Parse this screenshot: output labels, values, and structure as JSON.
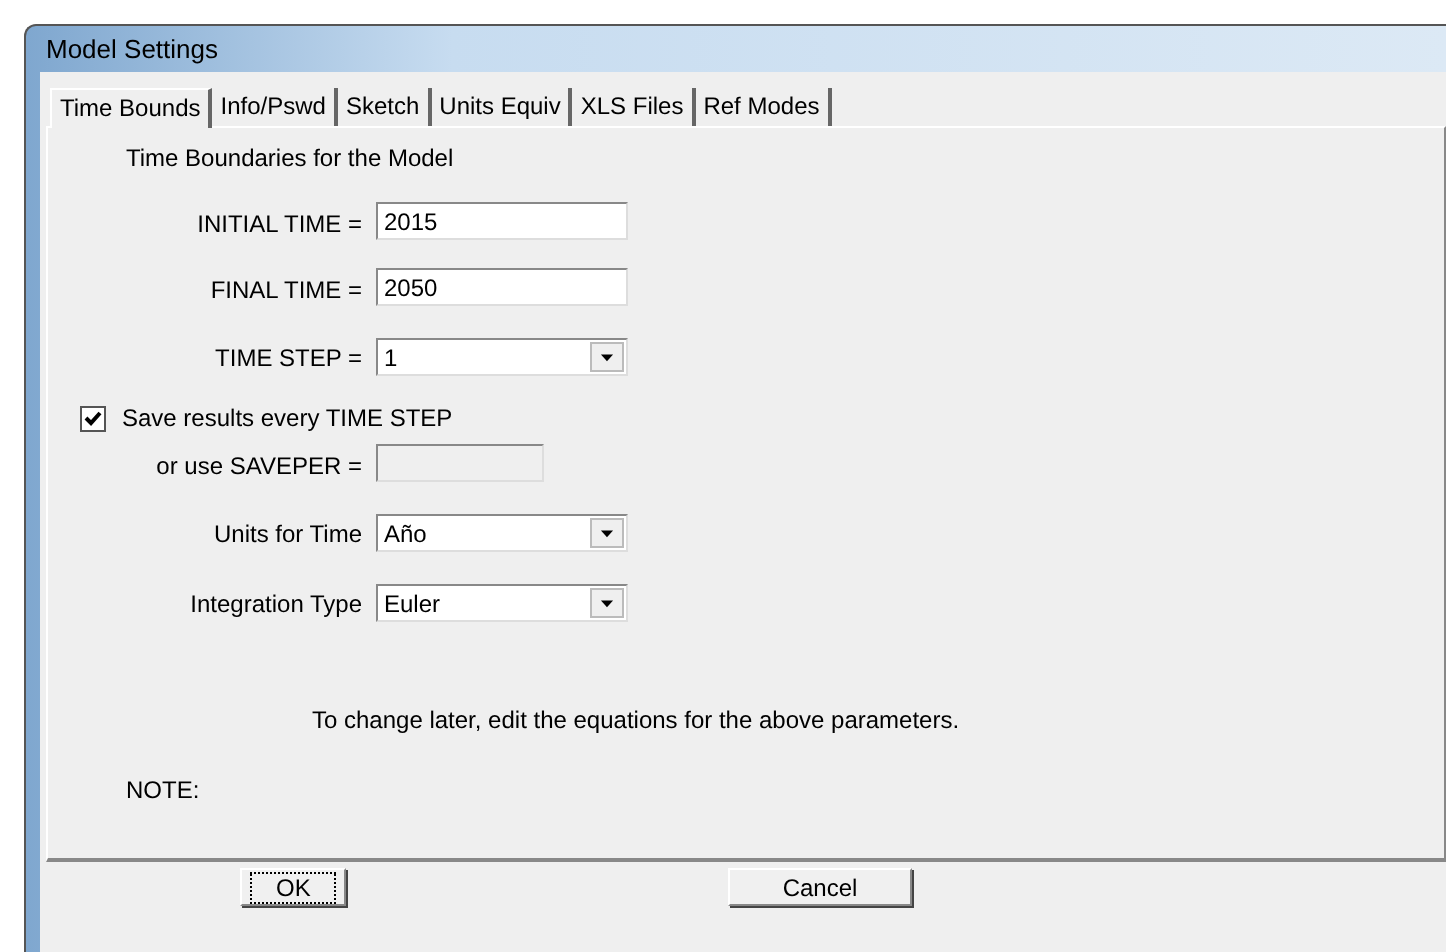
{
  "window": {
    "title": "Model Settings"
  },
  "tabs": [
    {
      "label": "Time Bounds",
      "selected": true
    },
    {
      "label": "Info/Pswd",
      "selected": false
    },
    {
      "label": "Sketch",
      "selected": false
    },
    {
      "label": "Units Equiv",
      "selected": false
    },
    {
      "label": "XLS Files",
      "selected": false
    },
    {
      "label": "Ref Modes",
      "selected": false
    }
  ],
  "heading": "Time Boundaries for the Model",
  "fields": [
    {
      "kind": "text",
      "label": "INITIAL TIME =",
      "value": "2015",
      "disabled": false
    },
    {
      "kind": "text",
      "label": "FINAL TIME =",
      "value": "2050",
      "disabled": false
    },
    {
      "kind": "select",
      "label": "TIME STEP =",
      "value": "1"
    },
    {
      "kind": "checkbox",
      "label": "Save results every TIME STEP",
      "checked": true
    },
    {
      "kind": "text",
      "label": "or use SAVEPER =",
      "disabled": true
    },
    {
      "kind": "select",
      "label": "Units for Time",
      "value": "Año"
    },
    {
      "kind": "select",
      "label": "Integration Type",
      "value": "Euler"
    }
  ],
  "hint": "To change later, edit the equations for the above parameters.",
  "note_label": "NOTE:",
  "buttons": [
    {
      "label": "OK",
      "focused": true
    },
    {
      "label": "Cancel",
      "focused": false
    }
  ]
}
